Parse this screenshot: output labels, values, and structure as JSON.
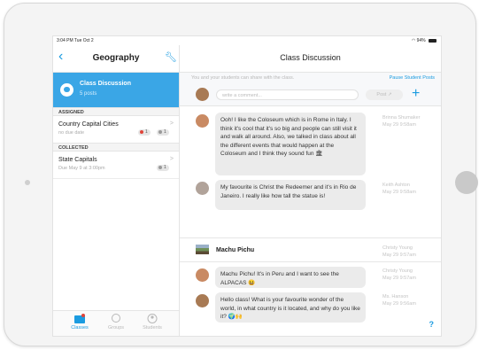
{
  "status_bar": {
    "time": "3:04 PM  Tue Oct 2",
    "battery": "94%"
  },
  "sidebar": {
    "title": "Geography",
    "back_icon": "chevron-left-icon",
    "settings_icon": "wrench-icon",
    "active_class": {
      "title": "Class Discussion",
      "subtitle": "5 posts",
      "icon": "chat-bubble-icon"
    },
    "sections": [
      {
        "label": "ASSIGNED"
      },
      {
        "label": "COLLECTED"
      }
    ],
    "items": [
      {
        "title": "Country Capital Cities",
        "subtitle": "no due date",
        "badge_red": "1",
        "badge_grey": "1"
      },
      {
        "title": "State Capitals",
        "subtitle": "Due May 9 at 3:00pm",
        "badge_grey": "1"
      }
    ],
    "tabs": [
      {
        "label": "Classes",
        "icon": "folder-icon",
        "color": "#1a9be0"
      },
      {
        "label": "Groups",
        "icon": "groups-icon",
        "color": "#b8b8b8"
      },
      {
        "label": "Students",
        "icon": "student-icon",
        "color": "#b8b8b8"
      }
    ]
  },
  "main": {
    "title": "Class Discussion",
    "info_text": "You and your students can share with the class.",
    "pause_label": "Pause Student Posts",
    "composer": {
      "placeholder": "write a comment...",
      "post_label": "Post",
      "add_icon": "plus-icon"
    },
    "posts": [
      {
        "text": "Ooh! I like the Coloseum which is in Rome in Italy. I think it's cool that it's so big and people can still visit it and walk all around. Also, we talked in class about all the different events that would happen at the Coloseum and I think they sound fun 🏛",
        "author": "Brinna Shumaker",
        "time": "May 29 9:58am"
      },
      {
        "text": "My favourite is Christ the Redeemer and it's in Rio de Janeiro. I really like how tall the statue is!",
        "author": "Keith Ashton",
        "time": "May 29 9:58am"
      }
    ],
    "thread": {
      "title": "Machu Pichu",
      "author": "Christy Young",
      "time": "May 29 9:57am"
    },
    "replies": [
      {
        "text": "Machu Pichu! It's in Peru and I want to see the ALPACAS 😆",
        "author": "Christy Young",
        "time": "May 29 9:57am"
      },
      {
        "text": "Hello class! What is your favourite wonder of the world, in what country is it located, and why do you like it? 🌍🙌",
        "author": "Ms. Hanson",
        "time": "May 29 9:56am"
      }
    ],
    "help_label": "?"
  },
  "colors": {
    "accent": "#1a9be0",
    "selected_row": "#3aa6e6",
    "bubble": "#ebebeb"
  }
}
